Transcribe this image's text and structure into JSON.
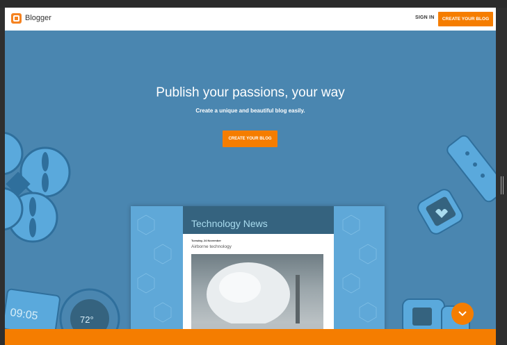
{
  "header": {
    "brand": "Blogger",
    "sign_in": "SIGN IN",
    "create_blog": "CREATE YOUR BLOG",
    "logo_icon": "blogger-logo-icon"
  },
  "hero": {
    "title": "Publish your passions, your way",
    "subtitle": "Create a unique and beautiful blog easily.",
    "create_blog": "CREATE YOUR BLOG"
  },
  "mockup": {
    "blog_title": "Technology News",
    "post_date": "Tuesday, 24 November",
    "post_title": "Airborne technology"
  },
  "decor": {
    "watch_time": "09:05",
    "thermostat": "72°"
  },
  "colors": {
    "page_bg": "#4a86b0",
    "accent": "#f57d00",
    "header_bg": "#ffffff",
    "mock_head": "#35637f",
    "mock_side": "#5fa8d8"
  },
  "icons": {
    "scroll_down": "chevron-down-icon"
  }
}
